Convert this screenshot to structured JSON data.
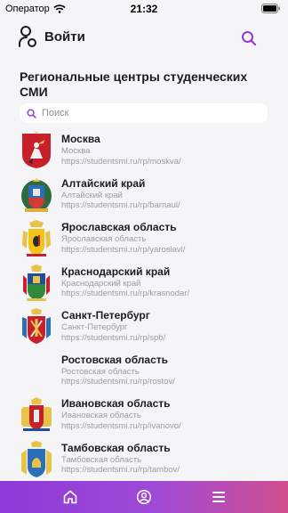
{
  "status_bar": {
    "carrier": "Оператор",
    "time": "21:32"
  },
  "header": {
    "login_label": "Войти"
  },
  "section_title": "Региональные центры студенческих СМИ",
  "search": {
    "placeholder": "Поиск",
    "value": ""
  },
  "regions": [
    {
      "name": "Москва",
      "subtitle": "Москва",
      "url": "https://studentsmi.ru/rp/moskva/"
    },
    {
      "name": "Алтайский край",
      "subtitle": "Алтайский край",
      "url": "https://studentsmi.ru/rp/barnaul/"
    },
    {
      "name": "Ярославская область",
      "subtitle": "Ярославская область",
      "url": "https://studentsmi.ru/rp/yaroslavl/"
    },
    {
      "name": "Краснодарский край",
      "subtitle": "Краснодарский край",
      "url": "https://studentsmi.ru/rp/krasnodar/"
    },
    {
      "name": "Санкт-Петербург",
      "subtitle": "Санкт-Петербург",
      "url": "https://studentsmi.ru/rp/spb/"
    },
    {
      "name": "Ростовская область",
      "subtitle": "Ростовская область",
      "url": "https://studentsmi.ru/rp/rostov/"
    },
    {
      "name": "Ивановская область",
      "subtitle": "Ивановская область",
      "url": "https://studentsmi.ru/rp/ivanovo/"
    },
    {
      "name": "Тамбовская область",
      "subtitle": "Тамбовская область",
      "url": "https://studentsmi.ru/rp/tambov/"
    }
  ],
  "tab_bar": {
    "tabs": [
      "home-icon",
      "profile-icon",
      "menu-icon"
    ]
  },
  "colors": {
    "accent": "#8e3ad8",
    "gradient_end": "#d14f90",
    "background": "#f5f5f7"
  }
}
